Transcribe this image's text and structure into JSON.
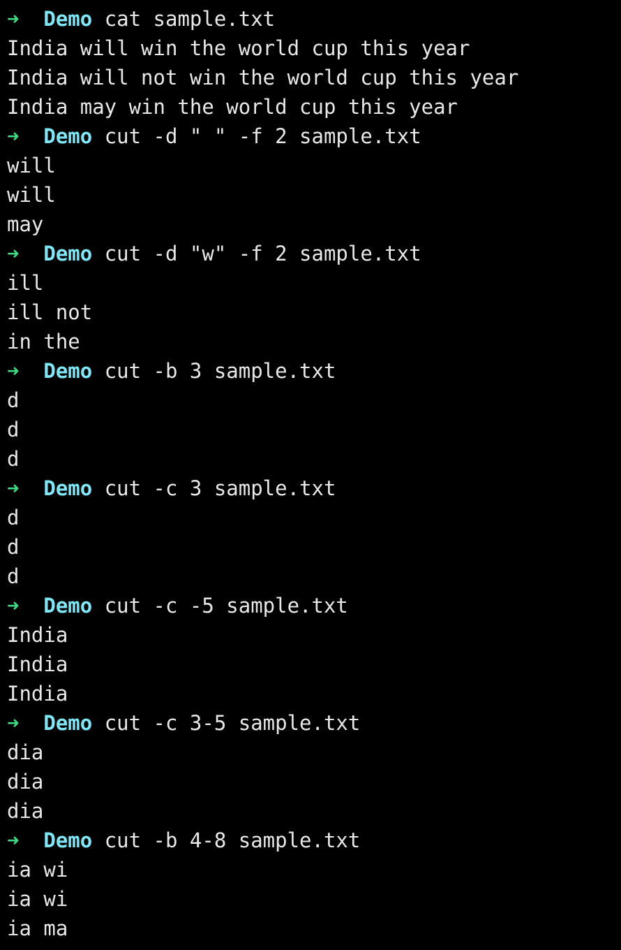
{
  "prompt": {
    "symbol": "➜",
    "dir": "Demo",
    "colors": {
      "arrow": "#3ddc84",
      "dir": "#7ee7f5",
      "text": "#e8e8e8",
      "background": "#000000"
    }
  },
  "blocks": [
    {
      "command": "cat sample.txt",
      "output": [
        "India will win the world cup this year",
        "India will not win the world cup this year",
        "India may win the world cup this year"
      ]
    },
    {
      "command": "cut -d \" \" -f 2 sample.txt",
      "output": [
        "will",
        "will",
        "may"
      ]
    },
    {
      "command": "cut -d \"w\" -f 2 sample.txt",
      "output": [
        "ill",
        "ill not",
        "in the"
      ]
    },
    {
      "command": "cut -b 3 sample.txt",
      "output": [
        "d",
        "d",
        "d"
      ]
    },
    {
      "command": "cut -c 3 sample.txt",
      "output": [
        "d",
        "d",
        "d"
      ]
    },
    {
      "command": "cut -c -5 sample.txt",
      "output": [
        "India",
        "India",
        "India"
      ]
    },
    {
      "command": "cut -c 3-5 sample.txt",
      "output": [
        "dia",
        "dia",
        "dia"
      ]
    },
    {
      "command": "cut -b 4-8 sample.txt",
      "output": [
        "ia wi",
        "ia wi",
        "ia ma"
      ]
    }
  ]
}
